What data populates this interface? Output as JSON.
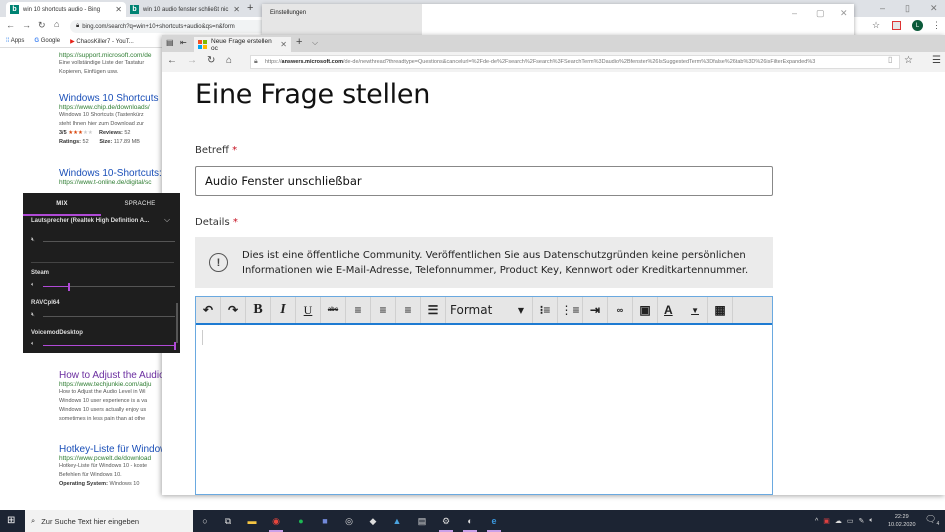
{
  "chrome": {
    "tabs": [
      {
        "title": "win 10 shortcuts audio - Bing",
        "active": true
      },
      {
        "title": "win 10 audio fenster schließt nic",
        "active": false
      }
    ],
    "new_tab_label": "+",
    "url": "bing.com/search?q=win+10+shortcuts+audio&qs=n&form",
    "bookmarks": [
      "Apps",
      "Google",
      "ChaosKiller7 - YouT..."
    ],
    "profile_initial": "L"
  },
  "bing_results": {
    "top_snippet": {
      "url": "https://support.microsoft.com/de",
      "desc": [
        "Eine vollständige Liste der Tastatur",
        "Kopieren, Einfügen usw."
      ]
    },
    "results": [
      {
        "title": "Windows 10 Shortcuts",
        "url": "https://www.chip.de/downloads/",
        "desc": [
          "Windows 10 Shortcuts (Tastenkürz",
          "steht Ihnen hier zum Download zur"
        ],
        "rating": "3/5",
        "reviews_label": "Reviews:",
        "reviews": "52",
        "ratings_label": "Ratings:",
        "ratings": "52",
        "size_label": "Size:",
        "size": "117.89 MB"
      },
      {
        "title": "Windows 10-Shortcuts:",
        "url": "https://www.t-online.de/digital/sc"
      },
      {
        "title": "How to Adjust the Audio",
        "url": "https://www.techjunkie.com/adju",
        "desc": [
          "How to Adjust the Audio Level in Wi",
          "Windows 10 user experience is a va",
          "Windows 10 users actually enjoy us",
          "sometimes in less pain than at othe"
        ]
      },
      {
        "title": "Hotkey-Liste für Window",
        "url": "https://www.pcwelt.de/download",
        "desc": [
          "Hotkey-Liste für Windows 10 - koste",
          "Befehlen für Windows 10."
        ],
        "os_label": "Operating System:",
        "os": "Windows 10"
      }
    ]
  },
  "settings_window": {
    "title": "Einstellungen"
  },
  "edge": {
    "tab_title": "Neue Frage erstellen oc",
    "url_prefix": "https://",
    "url_domain": "answers.microsoft.com",
    "url_rest": "/de-de/newthread?threadtype=Questions&cancelurl=%2Fde-de%2Fsearch%2Fsearch%3FSearchTerm%3Daudio%2Bfenster%26IsSuggestedTerm%3Dfalse%26tab%3D%26isFilterExpanded%3"
  },
  "form": {
    "title": "Eine Frage stellen",
    "subject_label": "Betreff",
    "required_mark": "*",
    "subject_value": "Audio Fenster unschließbar",
    "details_label": "Details",
    "notice_line1": "Dies ist eine öffentliche Community. Veröffentlichen Sie aus Datenschutzgründen keine persönlichen",
    "notice_line2": "Informationen wie E-Mail-Adresse, Telefonnummer, Product Key, Kennwort oder Kreditkartennummer.",
    "toolbar": {
      "undo": "↶",
      "redo": "↷",
      "bold": "B",
      "italic": "I",
      "underline": "U",
      "strike": "abc",
      "format_label": "Format",
      "font_color": "A"
    }
  },
  "mixer": {
    "tabs": [
      "MIX",
      "SPRACHE"
    ],
    "device": "Lautsprecher (Realtek High Definition A...",
    "master_muted": true,
    "apps": [
      {
        "name": "Steam",
        "muted": false,
        "level": 0.2
      },
      {
        "name": "RAVCpl64",
        "muted": true,
        "level": 1.0
      },
      {
        "name": "VoicemodDesktop",
        "muted": false,
        "level": 1.0
      }
    ]
  },
  "taskbar": {
    "search_placeholder": "Zur Suche Text hier eingeben",
    "time": "22:29",
    "date": "10.02.2020",
    "notification_count": "4"
  }
}
